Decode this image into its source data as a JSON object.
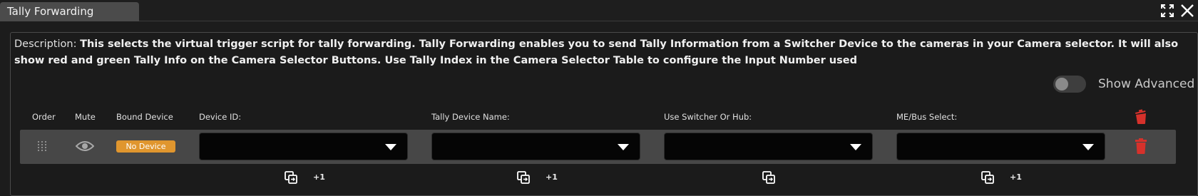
{
  "window": {
    "tab_title": "Tally Forwarding",
    "icons": [
      "expand-icon",
      "close-icon"
    ]
  },
  "description": {
    "label": "Description:",
    "text": "This selects the virtual trigger script for tally forwarding. Tally Forwarding enables you to send Tally Information from a Switcher Device to the cameras in your Camera selector. It will also show red and green Tally Info on the Camera Selector Buttons. Use Tally Index in the Camera Selector Table to configure the Input Number used"
  },
  "advanced": {
    "label": "Show Advanced",
    "enabled": false
  },
  "table": {
    "headers": {
      "order": "Order",
      "mute": "Mute",
      "bound_device": "Bound Device",
      "device_id": "Device ID:",
      "tally_device_name": "Tally Device Name:",
      "use_switcher_or_hub": "Use Switcher Or Hub:",
      "me_bus_select": "ME/Bus Select:"
    },
    "row": {
      "bound_device_badge": "No Device",
      "device_id_value": "",
      "tally_device_name_value": "",
      "use_switcher_or_hub_value": "",
      "me_bus_select_value": ""
    },
    "footer": {
      "device_id_plus": "+1",
      "tally_device_name_plus": "+1",
      "me_bus_select_plus": "+1"
    }
  },
  "colors": {
    "badge": "#e0962e",
    "delete": "#d6312b",
    "row_bg": "#474747",
    "select_bg": "#050505"
  }
}
